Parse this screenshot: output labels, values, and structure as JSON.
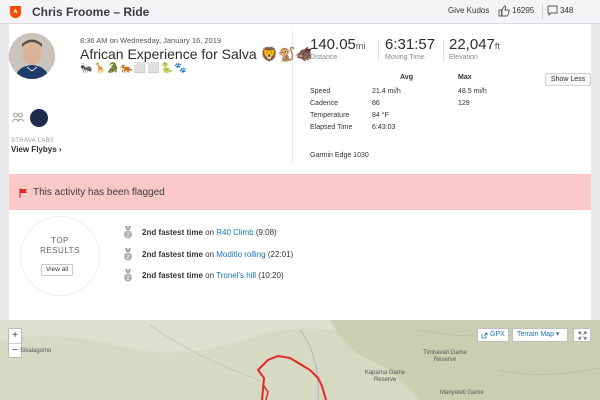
{
  "header": {
    "title": "Chris Froome – Ride",
    "give_kudos": "Give Kudos",
    "kudos_count": "16295",
    "comment_count": "348"
  },
  "activity": {
    "when": "8:36 AM on Wednesday, January 16, 2019",
    "name": "African Experience for Salva 🦁🐒🐗",
    "emoji_line": "🐜🦒🐊🐅⬜⬜🐍🐾"
  },
  "social": {
    "club_label": "STRAVA LABS",
    "view_flybys": "View Flybys ›"
  },
  "stats": [
    {
      "value": "140.05",
      "unit": "mi",
      "label": "Distance"
    },
    {
      "value": "6:31:57",
      "unit": "",
      "label": "Moving Time"
    },
    {
      "value": "22,047",
      "unit": "ft",
      "label": "Elevation"
    }
  ],
  "details": {
    "avg_header": "Avg",
    "max_header": "Max",
    "show_less": "Show Less",
    "rows": [
      {
        "label": "Speed",
        "avg": "21.4 mi/h",
        "max": "48.5 mi/h"
      },
      {
        "label": "Cadence",
        "avg": "86",
        "max": "129"
      },
      {
        "label": "Temperature",
        "avg": "84 °F",
        "max": ""
      },
      {
        "label": "Elapsed Time",
        "avg": "6:43:03",
        "max": ""
      }
    ],
    "device": "Garmin Edge 1030"
  },
  "flag": {
    "text": "This activity has been flagged"
  },
  "results": {
    "title_line1": "TOP",
    "title_line2": "RESULTS",
    "view_all": "View all",
    "items": [
      {
        "rank": "2",
        "bold": "2nd fastest time",
        "on": " on ",
        "segment": "R40 Climb",
        "time": " (9:08)"
      },
      {
        "rank": "2",
        "bold": "2nd fastest time",
        "on": " on ",
        "segment": "Moditlo rolling",
        "time": " (22:01)"
      },
      {
        "rank": "2",
        "bold": "2nd fastest time",
        "on": " on ",
        "segment": "Tronel's hill",
        "time": " (10:20)"
      }
    ]
  },
  "map": {
    "zoom_in": "+",
    "zoom_out": "−",
    "gpx": "GPX",
    "terrain": "Terrain Map ▾",
    "places": [
      "Sikalagomo",
      "Timbavati Game Reserve",
      "Kapama Game Reserve",
      "Manyeleti Game"
    ]
  },
  "colors": {
    "brand": "#fc4c02",
    "flag_bg": "#f8c9c6",
    "flag_icon": "#e0282a",
    "link": "#1a73b7",
    "route": "#e8262a"
  }
}
